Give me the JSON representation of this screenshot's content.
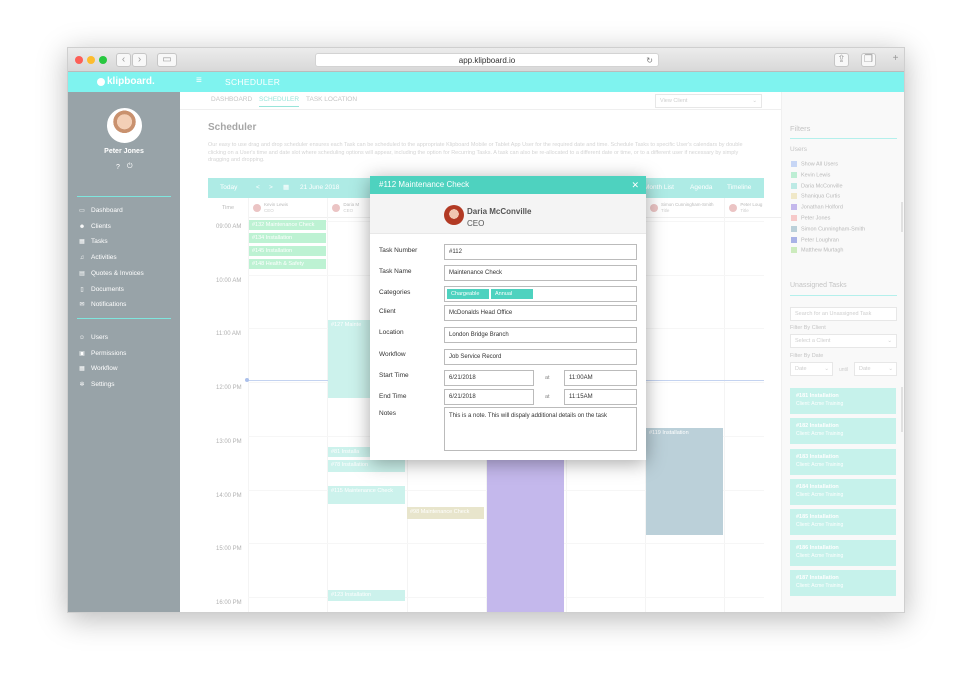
{
  "browser": {
    "url": "app.klipboard.io"
  },
  "app": {
    "brand": "klipboard.",
    "section": "SCHEDULER"
  },
  "user": {
    "name": "Peter Jones",
    "help": "?",
    "power": "⏻"
  },
  "nav": {
    "main": [
      "Dashboard",
      "Clients",
      "Tasks",
      "Activities",
      "Quotes & Invoices",
      "Documents",
      "Notifications"
    ],
    "main_icons": [
      "monitor-icon",
      "clients-icon",
      "calendar-icon",
      "bell-icon",
      "invoice-icon",
      "document-icon",
      "notification-icon"
    ],
    "admin": [
      "Users",
      "Permissions",
      "Workflow",
      "Settings"
    ],
    "admin_icons": [
      "users-icon",
      "lock-icon",
      "workflow-icon",
      "gear-icon"
    ]
  },
  "tabs": {
    "dashboard": "DASHBOARD",
    "scheduler": "SCHEDULER",
    "task_location": "TASK LOCATION",
    "view_client": "View Client"
  },
  "page": {
    "title": "Scheduler",
    "description": "Our easy to use drag and drop scheduler ensures each Task can be scheduled to the appropriate Klipboard Mobile or Tablet App User for the required date and time. Schedule Tasks to specific User's calendars by double clicking on a User's time and date slot where scheduling options will appear, including the option for Recurring Tasks. A task can also be re-allocated to a different date or time, or to a different user if necessary by simply dragging and dropping."
  },
  "calendar": {
    "today": "Today",
    "prev": "<",
    "next": ">",
    "date": "21 June 2018",
    "views": [
      "Month List",
      "Agenda",
      "Timeline"
    ],
    "time_label": "Time",
    "columns": [
      {
        "name": "Kevin Lewis",
        "role": "CEO"
      },
      {
        "name": "Daria M",
        "role": "CEO"
      },
      {
        "name": "",
        "role": ""
      },
      {
        "name": "",
        "role": ""
      },
      {
        "name": "",
        "role": ""
      },
      {
        "name": "Simon Cunningham-Smith",
        "role": "Title"
      },
      {
        "name": "Peter Loug",
        "role": "Title"
      }
    ],
    "times": [
      "09:00 AM",
      "10:00 AM",
      "11:00 AM",
      "12:00 PM",
      "13:00 PM",
      "14:00 PM",
      "15:00 PM",
      "16:00 PM"
    ],
    "events": [
      {
        "label": "#132 Maintenance Check",
        "color": "#8de8b4"
      },
      {
        "label": "#134 Installation",
        "color": "#8de8b4"
      },
      {
        "label": "#145 Installation",
        "color": "#8de8b4"
      },
      {
        "label": "#148 Health & Safety",
        "color": "#8de8b4"
      },
      {
        "label": "#127 Mainte",
        "color": "#a8e8de"
      },
      {
        "label": "#81 Installa",
        "color": "#a8e8de"
      },
      {
        "label": "#78 Installation",
        "color": "#a8e8de"
      },
      {
        "label": "#115 Maintenance Check",
        "color": "#a8e8de"
      },
      {
        "label": "#98 Maintenance Check",
        "color": "#d8d3a8"
      },
      {
        "label": "#119 Installation",
        "color": "#8aaebe"
      },
      {
        "label": "#123 Installation",
        "color": "#a8e8de"
      },
      {
        "label": "",
        "color": "#9a86df"
      }
    ]
  },
  "filters": {
    "title": "Filters",
    "users_label": "Users",
    "users": [
      {
        "name": "Show All Users",
        "color": "#9fb8ee"
      },
      {
        "name": "Kevin Lewis",
        "color": "#8de2b5"
      },
      {
        "name": "Daria McConville",
        "color": "#8ddbd2"
      },
      {
        "name": "Shaniqua Curtis",
        "color": "#e5d7a0"
      },
      {
        "name": "Jonathan Holford",
        "color": "#9a86df"
      },
      {
        "name": "Peter Jones",
        "color": "#f0a2a2"
      },
      {
        "name": "Simon Cunningham-Smith",
        "color": "#8aaebe"
      },
      {
        "name": "Peter Loughran",
        "color": "#6c7ad4"
      },
      {
        "name": "Matthew Murtagh",
        "color": "#a7dd8e"
      }
    ],
    "unassigned_title": "Unassigned Tasks",
    "search_placeholder": "Search for an Unassigned Task",
    "filter_client_label": "Filter By Client",
    "client_placeholder": "Select a Client",
    "filter_date_label": "Filter By Date",
    "date_placeholder": "Date",
    "until": "until",
    "tasks": [
      {
        "title": "#181 Installation",
        "client": "Client: Acme Training"
      },
      {
        "title": "#182 Installation",
        "client": "Client: Acme Training"
      },
      {
        "title": "#183 Installation",
        "client": "Client: Acme Training"
      },
      {
        "title": "#184 Installation",
        "client": "Client: Acme Training"
      },
      {
        "title": "#185 Installation",
        "client": "Client: Acme Training"
      },
      {
        "title": "#186 Installation",
        "client": "Client: Acme Training"
      },
      {
        "title": "#187 Installation",
        "client": "Client: Acme Training"
      }
    ]
  },
  "modal": {
    "title": "#112 Maintenance Check",
    "close": "✕",
    "person": "Daria McConville",
    "role": "CEO",
    "labels": {
      "task_number": "Task Number",
      "task_name": "Task Name",
      "categories": "Categories",
      "client": "Client",
      "location": "Location",
      "workflow": "Workflow",
      "start_time": "Start Time",
      "end_time": "End Time",
      "notes": "Notes",
      "at": "at"
    },
    "values": {
      "task_number": "#112",
      "task_name": "Maintenance Check",
      "categories": [
        "Chargeable",
        "Annual"
      ],
      "client": "McDonalds Head Office",
      "location": "London Bridge Branch",
      "workflow": "Job Service Record",
      "start_date": "6/21/2018",
      "start_time": "11:00AM",
      "end_date": "6/21/2018",
      "end_time": "11:15AM",
      "notes": "This is a note. This will dispaly additional details on the task"
    }
  }
}
